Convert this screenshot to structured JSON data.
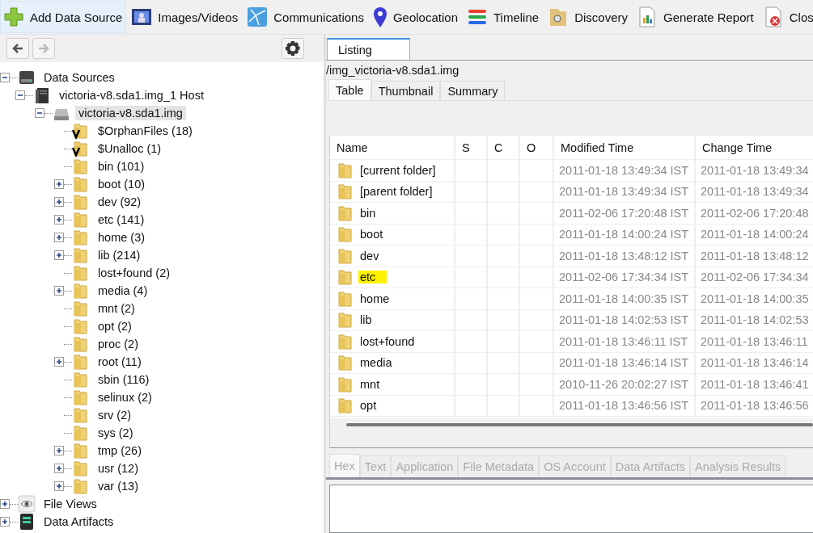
{
  "toolbar": [
    {
      "label": "Add Data Source",
      "kind": "add",
      "hovered": true
    },
    {
      "label": "Images/Videos",
      "kind": "images",
      "hovered": false
    },
    {
      "label": "Communications",
      "kind": "network",
      "hovered": false
    },
    {
      "label": "Geolocation",
      "kind": "pin",
      "hovered": false
    },
    {
      "label": "Timeline",
      "kind": "timeline",
      "hovered": false
    },
    {
      "label": "Discovery",
      "kind": "discovery",
      "hovered": false
    },
    {
      "label": "Generate Report",
      "kind": "report",
      "hovered": false
    },
    {
      "label": "Clos",
      "kind": "close",
      "hovered": false
    }
  ],
  "nav": {
    "back_disabled": false,
    "forward_disabled": true
  },
  "tree": [
    {
      "label": "Data Sources",
      "kind": "drive",
      "expanded": true,
      "selected": false,
      "children": [
        {
          "label": "victoria-v8.sda1.img_1 Host",
          "kind": "host",
          "expanded": true,
          "selected": false,
          "children": [
            {
              "label": "victoria-v8.sda1.img",
              "kind": "disk",
              "expanded": true,
              "selected": true,
              "children": [
                {
                  "label": "$OrphanFiles (18)",
                  "kind": "virtual",
                  "selected": false
                },
                {
                  "label": "$Unalloc (1)",
                  "kind": "virtual",
                  "selected": false
                },
                {
                  "label": "bin (101)",
                  "kind": "folder",
                  "selected": false
                },
                {
                  "label": "boot (10)",
                  "kind": "folder",
                  "expanded": false,
                  "selected": false
                },
                {
                  "label": "dev (92)",
                  "kind": "folder",
                  "expanded": false,
                  "selected": false
                },
                {
                  "label": "etc (141)",
                  "kind": "folder",
                  "expanded": false,
                  "selected": false
                },
                {
                  "label": "home (3)",
                  "kind": "folder",
                  "expanded": false,
                  "selected": false
                },
                {
                  "label": "lib (214)",
                  "kind": "folder",
                  "expanded": false,
                  "selected": false
                },
                {
                  "label": "lost+found (2)",
                  "kind": "folder",
                  "selected": false
                },
                {
                  "label": "media (4)",
                  "kind": "folder",
                  "expanded": false,
                  "selected": false
                },
                {
                  "label": "mnt (2)",
                  "kind": "folder",
                  "selected": false
                },
                {
                  "label": "opt (2)",
                  "kind": "folder",
                  "selected": false
                },
                {
                  "label": "proc (2)",
                  "kind": "folder",
                  "selected": false
                },
                {
                  "label": "root (11)",
                  "kind": "folder",
                  "expanded": false,
                  "selected": false
                },
                {
                  "label": "sbin (116)",
                  "kind": "folder",
                  "selected": false
                },
                {
                  "label": "selinux (2)",
                  "kind": "folder",
                  "selected": false
                },
                {
                  "label": "srv (2)",
                  "kind": "folder",
                  "selected": false
                },
                {
                  "label": "sys (2)",
                  "kind": "folder",
                  "selected": false
                },
                {
                  "label": "tmp (26)",
                  "kind": "folder",
                  "expanded": false,
                  "selected": false
                },
                {
                  "label": "usr (12)",
                  "kind": "folder",
                  "expanded": false,
                  "selected": false
                },
                {
                  "label": "var (13)",
                  "kind": "folder",
                  "expanded": false,
                  "selected": false
                }
              ]
            }
          ]
        }
      ]
    },
    {
      "label": "File Views",
      "kind": "views",
      "expanded": false,
      "selected": false
    },
    {
      "label": "Data Artifacts",
      "kind": "artifacts",
      "expanded": false,
      "selected": false
    }
  ],
  "listing_tab": "Listing",
  "path": "/img_victoria-v8.sda1.img",
  "view_tabs": [
    {
      "label": "Table",
      "selected": true
    },
    {
      "label": "Thumbnail",
      "selected": false
    },
    {
      "label": "Summary",
      "selected": false
    }
  ],
  "table": {
    "columns": [
      "Name",
      "S",
      "C",
      "O",
      "Modified Time",
      "Change Time"
    ],
    "rows": [
      {
        "name": "[current folder]",
        "modified": "2011-01-18 13:49:34 IST",
        "change": "2011-01-18 13:49:34",
        "highlighted": false
      },
      {
        "name": "[parent folder]",
        "modified": "2011-01-18 13:49:34 IST",
        "change": "2011-01-18 13:49:34",
        "highlighted": false
      },
      {
        "name": "bin",
        "modified": "2011-02-06 17:20:48 IST",
        "change": "2011-02-06 17:20:48",
        "highlighted": false
      },
      {
        "name": "boot",
        "modified": "2011-01-18 14:00:24 IST",
        "change": "2011-01-18 14:00:24",
        "highlighted": false
      },
      {
        "name": "dev",
        "modified": "2011-01-18 13:48:12 IST",
        "change": "2011-01-18 13:48:12",
        "highlighted": false
      },
      {
        "name": "etc",
        "modified": "2011-02-06 17:34:34 IST",
        "change": "2011-02-06 17:34:34",
        "highlighted": true
      },
      {
        "name": "home",
        "modified": "2011-01-18 14:00:35 IST",
        "change": "2011-01-18 14:00:35",
        "highlighted": false
      },
      {
        "name": "lib",
        "modified": "2011-01-18 14:02:53 IST",
        "change": "2011-01-18 14:02:53",
        "highlighted": false
      },
      {
        "name": "lost+found",
        "modified": "2011-01-18 13:46:11 IST",
        "change": "2011-01-18 13:46:11",
        "highlighted": false
      },
      {
        "name": "media",
        "modified": "2011-01-18 13:46:14 IST",
        "change": "2011-01-18 13:46:14",
        "highlighted": false
      },
      {
        "name": "mnt",
        "modified": "2010-11-26 20:02:27 IST",
        "change": "2011-01-18 13:46:41",
        "highlighted": false
      },
      {
        "name": "opt",
        "modified": "2011-01-18 13:46:56 IST",
        "change": "2011-01-18 13:46:56",
        "highlighted": false
      }
    ]
  },
  "content_tabs": [
    {
      "label": "Hex",
      "selected": true,
      "disabled": true
    },
    {
      "label": "Text",
      "selected": false,
      "disabled": true
    },
    {
      "label": "Application",
      "selected": false,
      "disabled": true
    },
    {
      "label": "File Metadata",
      "selected": false,
      "disabled": true
    },
    {
      "label": "OS Account",
      "selected": false,
      "disabled": true
    },
    {
      "label": "Data Artifacts",
      "selected": false,
      "disabled": true
    },
    {
      "label": "Analysis Results",
      "selected": false,
      "disabled": true
    }
  ]
}
